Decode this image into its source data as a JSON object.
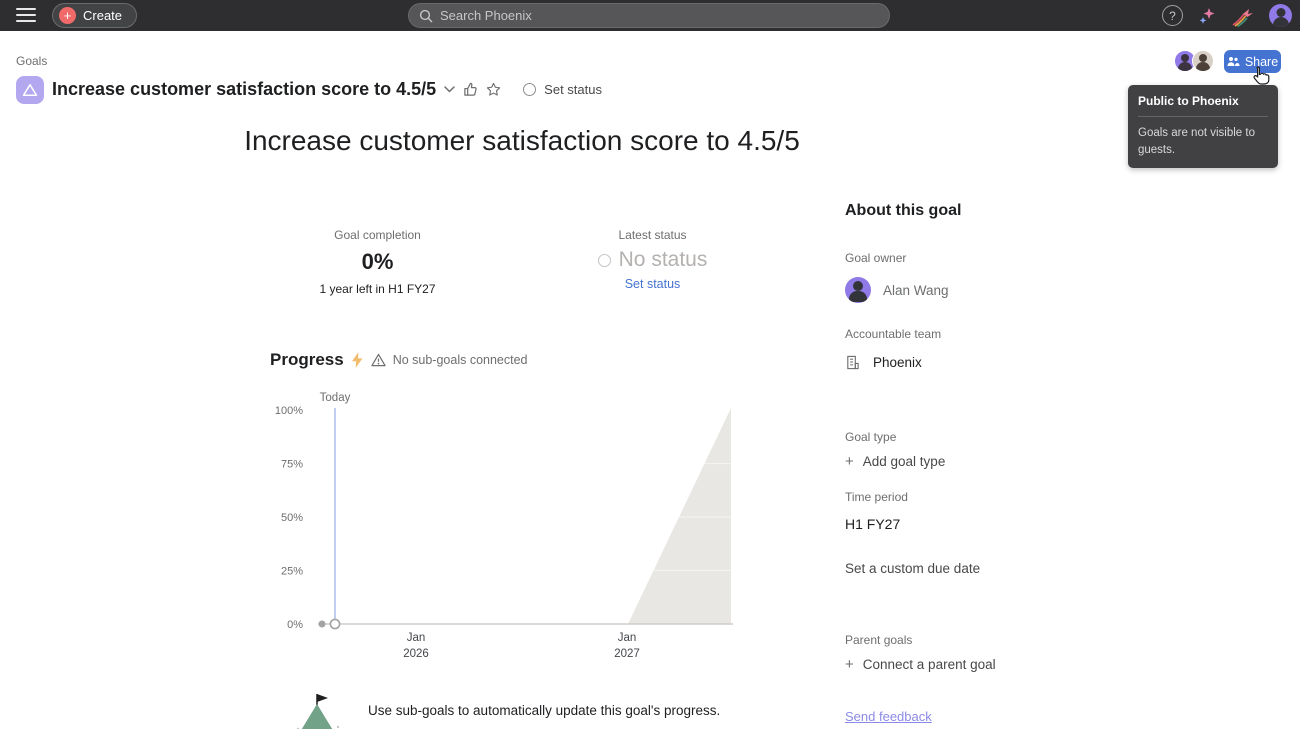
{
  "topbar": {
    "create_label": "Create",
    "search_placeholder": "Search Phoenix",
    "help_label": "?"
  },
  "header": {
    "breadcrumb": "Goals",
    "goal_title": "Increase customer satisfaction score to 4.5/5",
    "set_status_label": "Set status",
    "share_label": "Share"
  },
  "tooltip": {
    "title": "Public to Phoenix",
    "body": "Goals are not visible to guests."
  },
  "hero": {
    "title": "Increase customer satisfaction score to 4.5/5"
  },
  "stats": {
    "completion_label": "Goal completion",
    "completion_value": "0%",
    "completion_sub": "1 year left in H1 FY27",
    "status_label": "Latest status",
    "status_value": "No status",
    "status_action": "Set status"
  },
  "progress": {
    "heading": "Progress",
    "warning": "No sub-goals connected",
    "footer_note": "Use sub-goals to automatically update this goal's progress."
  },
  "chart_data": {
    "type": "area",
    "title": "Progress",
    "today_label": "Today",
    "y_ticks": [
      "100%",
      "75%",
      "50%",
      "25%",
      "0%"
    ],
    "ylim": [
      0,
      100
    ],
    "x_ticks": [
      {
        "month": "Jan",
        "year": "2026"
      },
      {
        "month": "Jan",
        "year": "2027"
      }
    ],
    "grid": "inside-area-only",
    "series": [
      {
        "name": "actual-progress",
        "points": [
          {
            "x": "start",
            "y": 0
          },
          {
            "x": "Today",
            "y": 0
          }
        ]
      },
      {
        "name": "expected-progress-area",
        "points": [
          {
            "x": "Today",
            "y": 0
          },
          {
            "x": "Jan 2027",
            "y": 0
          },
          {
            "x": "end of H1 FY27",
            "y": 100
          }
        ]
      }
    ],
    "markers": [
      {
        "name": "start-dot",
        "x": "start",
        "y": 0,
        "style": "filled"
      },
      {
        "name": "today-dot",
        "x": "Today",
        "y": 0,
        "style": "open"
      }
    ],
    "colors": {
      "area_fill": "#e9e7e4",
      "today_line": "#c2cdf2",
      "baseline": "#cfccc9"
    }
  },
  "sidebar": {
    "heading": "About this goal",
    "owner_label": "Goal owner",
    "owner_name": "Alan Wang",
    "team_label": "Accountable team",
    "team_name": "Phoenix",
    "goal_type_label": "Goal type",
    "goal_type_action": "Add goal type",
    "time_period_label": "Time period",
    "time_period_value": "H1 FY27",
    "due_date_action": "Set a custom due date",
    "parent_goals_label": "Parent goals",
    "parent_goals_action": "Connect a parent goal",
    "feedback_link": "Send feedback"
  },
  "colors": {
    "topbar_bg": "#2e2e30",
    "accent_blue": "#4573d2",
    "create_coral": "#f06a6a",
    "goal_icon_purple": "#b3a8f0",
    "link_purple": "#8b8ae6",
    "warning_bolt": "#f1bd6c",
    "mountain_green": "#72a287"
  }
}
